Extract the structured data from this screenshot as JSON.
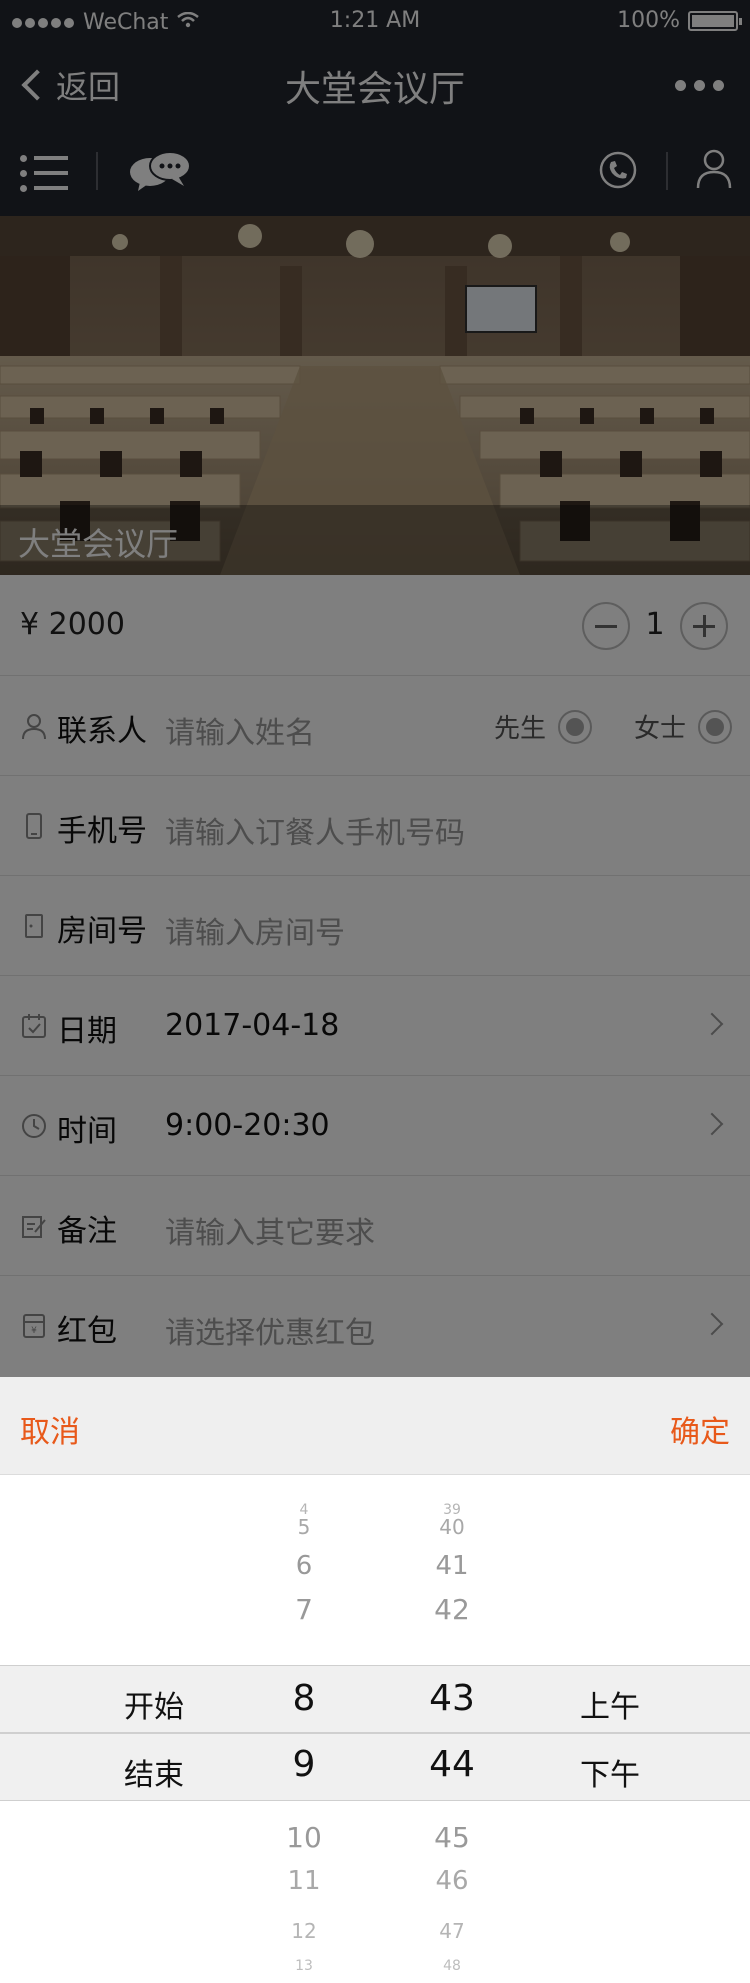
{
  "status_bar": {
    "carrier": "WeChat",
    "time": "1:21 AM",
    "battery": "100%"
  },
  "nav": {
    "back_label": "返回",
    "title": "大堂会议厅"
  },
  "hero": {
    "caption": "大堂会议厅"
  },
  "order": {
    "price": "¥ 2000",
    "quantity": "1"
  },
  "form": {
    "contact": {
      "label": "联系人",
      "placeholder": "请输入姓名",
      "mr": "先生",
      "ms": "女士"
    },
    "phone": {
      "label": "手机号",
      "placeholder": "请输入订餐人手机号码"
    },
    "room": {
      "label": "房间号",
      "placeholder": "请输入房间号"
    },
    "date": {
      "label": "日期",
      "value": "2017-04-18"
    },
    "time": {
      "label": "时间",
      "value": "9:00-20:30"
    },
    "remark": {
      "label": "备注",
      "placeholder": "请输入其它要求"
    },
    "coupon": {
      "label": "红包",
      "placeholder": "请选择优惠红包"
    }
  },
  "picker": {
    "cancel": "取消",
    "confirm": "确定",
    "start_label": "开始",
    "end_label": "结束",
    "am": "上午",
    "pm": "下午",
    "hours": [
      "4",
      "5",
      "6",
      "7",
      "8",
      "9",
      "10",
      "11",
      "12",
      "13"
    ],
    "minutes": [
      "39",
      "40",
      "41",
      "42",
      "43",
      "44",
      "45",
      "46",
      "47",
      "48"
    ]
  }
}
